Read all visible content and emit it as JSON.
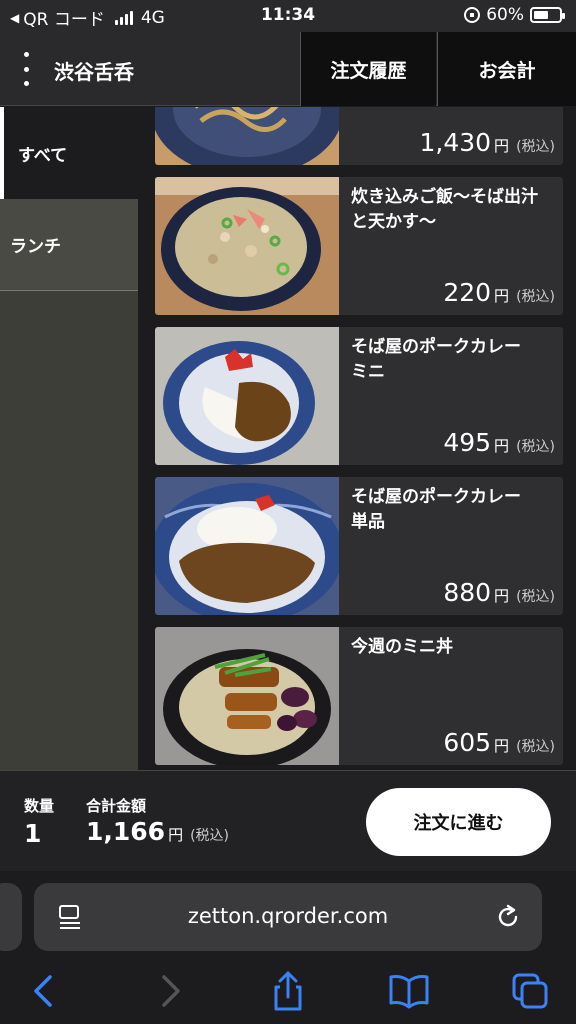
{
  "status": {
    "back_app": "QR コード",
    "network": "4G",
    "time": "11:34",
    "battery_text": "60%",
    "battery_level": 0.6
  },
  "header": {
    "store_name": "渋谷舌呑",
    "order_history": "注文履歴",
    "checkout": "お会計"
  },
  "sidebar": {
    "items": [
      {
        "label": "すべて",
        "selected": true
      },
      {
        "label": "ランチ",
        "selected": false
      }
    ]
  },
  "menu": {
    "items": [
      {
        "name": "",
        "price": "1,430",
        "yen": "円",
        "tax": "(税込)",
        "image": "soba-noodle-bowl"
      },
      {
        "name": "炊き込みご飯〜そば出汁と天かす〜",
        "price": "220",
        "yen": "円",
        "tax": "(税込)",
        "image": "takikomi-rice-bowl"
      },
      {
        "name": "そば屋のポークカレー　ミニ",
        "price": "495",
        "yen": "円",
        "tax": "(税込)",
        "image": "pork-curry-mini"
      },
      {
        "name": "そば屋のポークカレー　単品",
        "price": "880",
        "yen": "円",
        "tax": "(税込)",
        "image": "pork-curry-single"
      },
      {
        "name": "今週のミニ丼",
        "price": "605",
        "yen": "円",
        "tax": "(税込)",
        "image": "mini-donburi"
      }
    ]
  },
  "order": {
    "qty_label": "数量",
    "qty": "1",
    "total_label": "合計金額",
    "total": "1,166",
    "yen": "円",
    "tax": "(税込)",
    "proceed": "注文に進む"
  },
  "browser": {
    "url": "zetton.qrorder.com",
    "accent": "#3b82f6"
  }
}
